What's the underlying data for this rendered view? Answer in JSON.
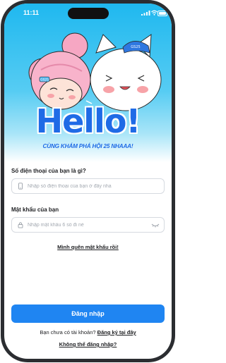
{
  "status_bar": {
    "time": "11:11"
  },
  "hero": {
    "title": "Hello!",
    "tagline": "CÙNG KHÁM PHÁ HỘI 25 NHAAA!",
    "cat_cap_text": "GS25",
    "girl_clip_text": "GS25",
    "colors": {
      "background": "#1fb8ef",
      "title": "#1f6be6"
    }
  },
  "form": {
    "phone_label": "Số điện thoại của bạn là gì?",
    "phone_placeholder": "Nhập số điện thoại của bạn ở đây nha",
    "password_label": "Mật khẩu của bạn",
    "password_placeholder": "Nhập mật khẩu 6 số đi nè",
    "forgot_link": "Mình quên mật khẩu rồi!"
  },
  "actions": {
    "login_button": "Đăng nhập",
    "signup_prompt": "Bạn chưa có tài khoản?",
    "signup_link": "Đăng ký tại đây",
    "help_link": "Không thể đăng nhập?",
    "accent_color": "#1f85f2"
  }
}
